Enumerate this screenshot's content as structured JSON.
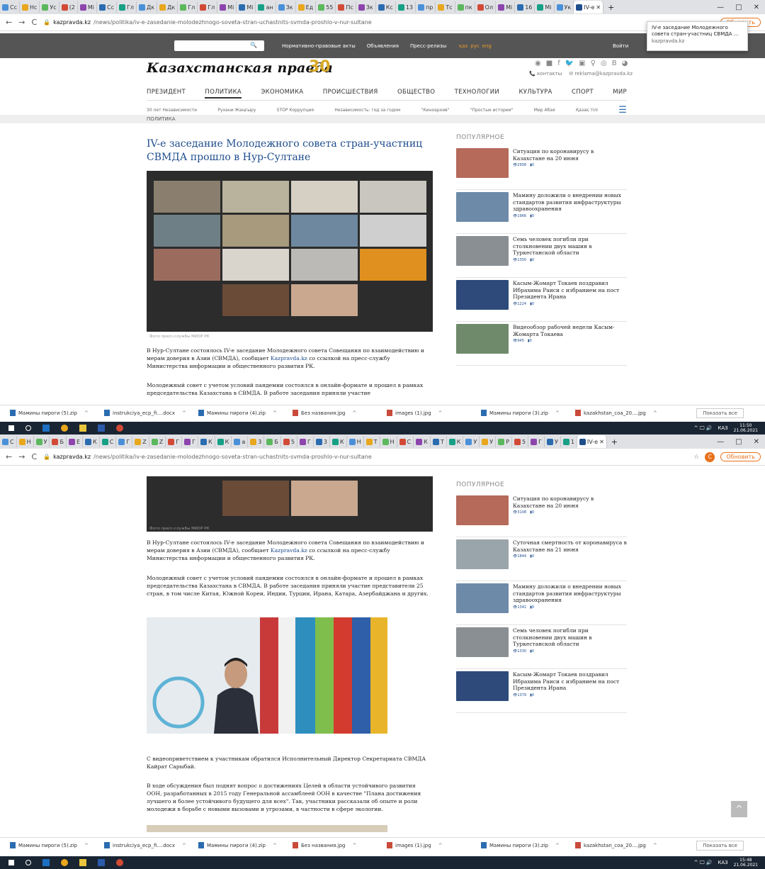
{
  "browser": {
    "tabs_top": [
      "Сс",
      "Нс",
      "Ус",
      "(2",
      "Мі",
      "Сс",
      "Гл",
      "Дк",
      "Дк",
      "Гл",
      "Гл",
      "Мі",
      "Мі",
      "ан",
      "Зк",
      "Ед",
      "55",
      "Пс",
      "Зк",
      "Кс",
      "13",
      "пр",
      "Тс",
      "пк",
      "Ол",
      "Мі",
      "16",
      "Мі",
      "Ук"
    ],
    "tabs_bottom": [
      "С",
      "Н",
      "У",
      "Б",
      "Е",
      "К",
      "С",
      "Г",
      "Z",
      "Z",
      "Г",
      "Г",
      "К",
      "К",
      "а",
      "3",
      "Б",
      "5",
      "Г",
      "3",
      "К",
      "Н",
      "Т",
      "Н",
      "С",
      "К",
      "Т",
      "К",
      "У",
      "У",
      "Р",
      "5",
      "Г",
      "У",
      "1"
    ],
    "active_tab_label": "IV-е",
    "new_tab": "+",
    "controls": [
      "—",
      "□",
      "✕"
    ],
    "url_host": "kazpravda.kz",
    "url_path": "/news/politika/iv-e-zasedanie-molodezhnogo-soveta-stran-uchastnits-svmda-proshlo-v-nur-sultane",
    "update_btn": "Обновить",
    "avatar_letter": "С",
    "tooltip_title": "IV-е заседание Молодежного совета стран-участниц СВМДА ...",
    "tooltip_domain": "kazpravda.kz"
  },
  "site": {
    "topbar_links": [
      "Нормативно-правовые акты",
      "Объявления",
      "Пресс-релизы"
    ],
    "langs": [
      "қаз",
      "рус",
      "eng"
    ],
    "login": "Войти",
    "logo": "Казахстанская правда",
    "logo_badge": "30",
    "social_icons": [
      "◉",
      "■",
      "f",
      "🐦",
      "▣",
      "♀",
      "◎",
      "B",
      "◕"
    ],
    "contacts": "контакты",
    "email": "reklama@kazpravda.kz",
    "main_nav": [
      "ПРЕЗИДЕНТ",
      "ПОЛИТИКА",
      "ЭКОНОМИКА",
      "ПРОИСШЕСТВИЯ",
      "ОБЩЕСТВО",
      "ТЕХНОЛОГИИ",
      "КУЛЬТУРА",
      "СПОРТ",
      "МИР"
    ],
    "sub_nav": [
      "30 лет Независимости",
      "Рухани Жаңғыру",
      "STOP Коррупция",
      "Независимость: год за годом",
      "\"Киноархив\"",
      "\"Простые истории\"",
      "Мир Абая",
      "Қазақ тілі"
    ],
    "rubric": "ПОЛИТИКА",
    "headline": "IV-е заседание Молодежного совета стран-участниц СВМДА прошло в Нур-Султане",
    "photo_caption": "Фото пресс-службы МИОР РК",
    "para1_a": "В Нур-Султане состоялось IV-е заседание Молодежного совета Совещания по взаимодействию и мерам доверия в Азии (СВМДА), сообщает ",
    "para1_link": "Kazpravda.kz",
    "para1_b": " со ссылкой на пресс-службу Министерства информации и общественного развития РК.",
    "para2_partial": "Молодежный совет с учетом условий пандемии состоялся в онлайн-формате и прошел в рамках председательства Казахстана в СВМДА. В работе заседания приняли участие",
    "para2_full": "Молодежный совет с учетом условий пандемии состоялся в онлайн-формате и прошел в рамках председательства Казахстана в СВМДА. В работе заседания приняли участие представители 25 стран, в том числе Китая, Южной Кореи, Индии, Турции, Ирана, Катара, Азербайджана и других.",
    "para3": "С видеоприветствием к участникам обратился Исполнительный Директор Секретариата СВМДА Кайрат Сарыбай.",
    "para4": "В ходе обсуждения был поднят вопрос о достижениях Целей в области устойчивого развития ООН, разработанных в 2015 году Генеральной ассамблеей ООН в качестве \"Плана достижения лучшего и более устойчивого будущего для всех\". Так, участники рассказали об опыте и роли молодежи в борьбе с новыми вызовами и угрозами, в частности в сфере экологии.",
    "popular_title": "ПОПУЛЯРНОЕ",
    "popular_top": [
      {
        "title": "Ситуация по коронавирусу в Казахстане на 20 июня",
        "views": "2958",
        "comments": "0",
        "color": "#b56a5a"
      },
      {
        "title": "Мамину доложили о внедрении новых стандартов развития инфраструктуры здравоохранения",
        "views": "1966",
        "comments": "0",
        "color": "#6d8aa8"
      },
      {
        "title": "Семь человек погибли при столкновении двух машин в Туркестанской области",
        "views": "1350",
        "comments": "0",
        "color": "#8a8f94"
      },
      {
        "title": "Касым-Жомарт Токаев поздравил Ибрахима Раиси с избранием на пост Президента Ирана",
        "views": "1224",
        "comments": "0",
        "color": "#2d4a7a"
      },
      {
        "title": "Видеообзор рабочей недели Касым-Жомарта Токаева",
        "views": "945",
        "comments": "0",
        "color": "#6f8a6a"
      }
    ],
    "popular_bottom": [
      {
        "title": "Ситуация по коронавирусу в Казахстане на 20 июня",
        "views": "3108",
        "comments": "0",
        "color": "#b56a5a"
      },
      {
        "title": "Суточная смертность от коронавируса в Казахстане на 21 июня",
        "views": "1844",
        "comments": "0",
        "color": "#9aa4ab"
      },
      {
        "title": "Мамину доложили о внедрении новых стандартов развития инфраструктуры здравоохранения",
        "views": "1341",
        "comments": "0",
        "color": "#6d8aa8"
      },
      {
        "title": "Семь человек погибли при столкновении двух машин в Туркестанской области",
        "views": "1330",
        "comments": "0",
        "color": "#8a8f94"
      },
      {
        "title": "Касым-Жомарт Токаев поздравил Ибрахима Раиси с избранием на пост Президента Ирана",
        "views": "1379",
        "comments": "0",
        "color": "#2d4a7a"
      }
    ]
  },
  "downloads": {
    "items": [
      {
        "name": "Мамины пироги (5).zip",
        "type": "zip"
      },
      {
        "name": "instrukciya_ecp_fi....docx",
        "type": "doc"
      },
      {
        "name": "Мамины пироги (4).zip",
        "type": "zip"
      },
      {
        "name": "Без названия.jpg",
        "type": "img"
      },
      {
        "name": "images (1).jpg",
        "type": "img"
      },
      {
        "name": "Мамины пироги (3).zip",
        "type": "zip"
      },
      {
        "name": "kazakhstan_coa_20....jpg",
        "type": "img"
      }
    ],
    "show_all": "Показать все"
  },
  "taskbar": {
    "lang": "КАЗ",
    "time_top": "11:50",
    "date_top": "21.06.2021",
    "time_bottom": "15:48",
    "date_bottom": "21.06.2021"
  }
}
